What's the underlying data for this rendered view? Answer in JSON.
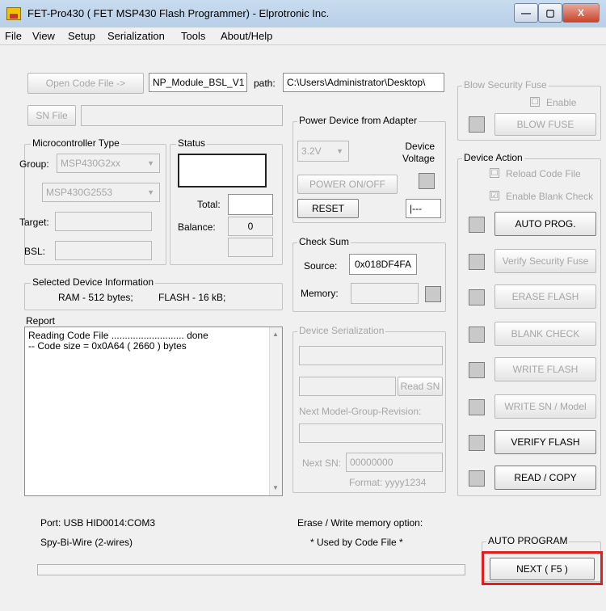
{
  "window": {
    "title": "FET-Pro430  ( FET MSP430 Flash Programmer)  -  Elprotronic Inc.",
    "minimize": "—",
    "maximize": "▢",
    "close": "X"
  },
  "menu": [
    "File",
    "View",
    "Setup",
    "Serialization",
    "Tools",
    "About/Help"
  ],
  "code": {
    "open_button": "Open Code File      ->",
    "filename": "NP_Module_BSL_V1",
    "path_label": "path:",
    "path": "C:\\Users\\Administrator\\Desktop\\"
  },
  "sn_file": {
    "button": "SN File",
    "value": ""
  },
  "mcu": {
    "group_title": "Microcontroller Type",
    "group_label": "Group:",
    "group_value": "MSP430G2xx",
    "device_value": "MSP430G2553",
    "target_label": "Target:",
    "bsl_label": "BSL:"
  },
  "status": {
    "title": "Status",
    "total_label": "Total:",
    "total_value": "",
    "balance_label": "Balance:",
    "balance_value": "0"
  },
  "power": {
    "title": "Power Device from Adapter",
    "voltage": "3.2V",
    "device_voltage": "Device\nVoltage",
    "onoff": "POWER ON/OFF",
    "reset": "RESET",
    "reset_indicator": "|---"
  },
  "checksum": {
    "title": "Check Sum",
    "source_label": "Source:",
    "source_value": "0x018DF4FA",
    "memory_label": "Memory:",
    "memory_value": ""
  },
  "selected": {
    "title": "Selected Device Information",
    "ram": "RAM -  512 bytes;",
    "flash": "FLASH - 16 kB;"
  },
  "report": {
    "title": "Report",
    "lines": [
      "Reading Code File ...........................          done",
      "-- Code size = 0x0A64 ( 2660 ) bytes"
    ]
  },
  "serial": {
    "title": "Device Serialization",
    "read_sn": "Read SN",
    "next_label": "Next Model-Group-Revision:",
    "next_sn_label": "Next SN:",
    "next_sn_value": "00000000",
    "format": "Format: yyyy1234"
  },
  "blow": {
    "title": "Blow Security Fuse",
    "enable": "Enable",
    "button": "BLOW FUSE"
  },
  "actions": {
    "title": "Device Action",
    "reload": "Reload Code File",
    "enable_blank": "Enable Blank Check",
    "auto_prog": "AUTO PROG.",
    "verify_fuse": "Verify Security Fuse",
    "erase": "ERASE FLASH",
    "blank": "BLANK CHECK",
    "write": "WRITE FLASH",
    "write_sn": "WRITE SN / Model",
    "verify": "VERIFY FLASH",
    "read": "READ / COPY"
  },
  "footer": {
    "port": "Port: USB HID0014:COM3",
    "mode": "Spy-Bi-Wire (2-wires)",
    "erase_title": "Erase / Write memory option:",
    "erase_value": "* Used by Code File *",
    "auto_title": "AUTO PROGRAM",
    "next": "NEXT  ( F5 )"
  },
  "checks": {
    "checked": "☑",
    "unchecked": "☐"
  }
}
